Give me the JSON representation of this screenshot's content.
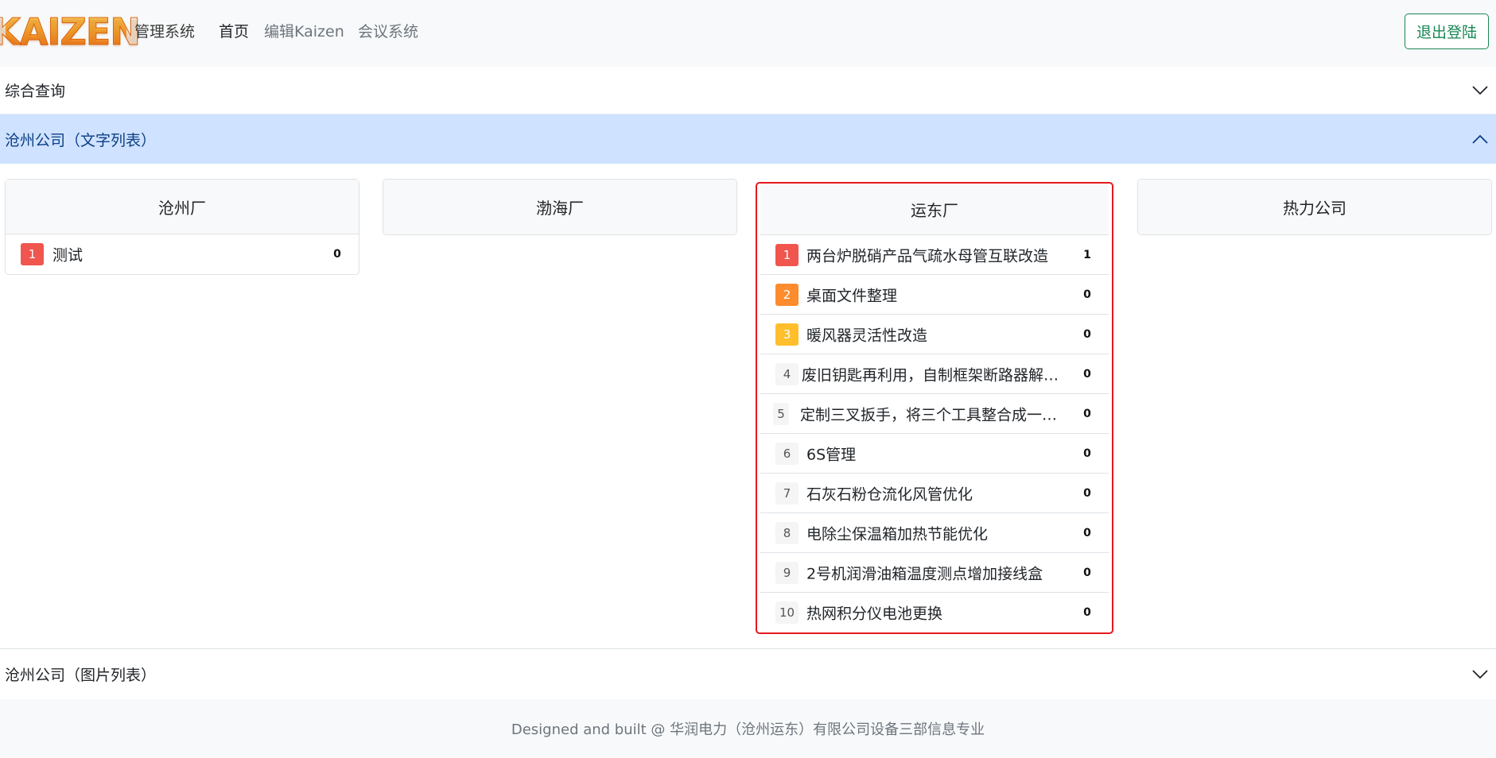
{
  "navbar": {
    "logo_text": "KAIZEN",
    "brand_text": "管理系统",
    "links": [
      {
        "label": "首页",
        "active": true
      },
      {
        "label": "编辑Kaizen",
        "active": false
      },
      {
        "label": "会议系统",
        "active": false
      }
    ],
    "logout_label": "退出登陆"
  },
  "accordion": [
    {
      "label": "综合查询",
      "expanded": false
    },
    {
      "label": "沧州公司（文字列表）",
      "expanded": true
    },
    {
      "label": "沧州公司（图片列表）",
      "expanded": false
    }
  ],
  "cards": [
    {
      "title": "沧州厂",
      "items": [
        {
          "rank": "1",
          "title": "测试",
          "count": "0"
        }
      ]
    },
    {
      "title": "渤海厂",
      "items": []
    },
    {
      "title": "运东厂",
      "highlighted": true,
      "items": [
        {
          "rank": "1",
          "title": "两台炉脱硝产品气疏水母管互联改造",
          "count": "1"
        },
        {
          "rank": "2",
          "title": "桌面文件整理",
          "count": "0"
        },
        {
          "rank": "3",
          "title": "暖风器灵活性改造",
          "count": "0"
        },
        {
          "rank": "4",
          "title": "废旧钥匙再利用，自制框架断路器解锁工具",
          "count": "0"
        },
        {
          "rank": "5",
          "title": "定制三叉扳手，将三个工具整合成一，方便携带使用",
          "count": "0"
        },
        {
          "rank": "6",
          "title": "6S管理",
          "count": "0"
        },
        {
          "rank": "7",
          "title": "石灰石粉仓流化风管优化",
          "count": "0"
        },
        {
          "rank": "8",
          "title": "电除尘保温箱加热节能优化",
          "count": "0"
        },
        {
          "rank": "9",
          "title": "2号机润滑油箱温度测点增加接线盒",
          "count": "0"
        },
        {
          "rank": "10",
          "title": "热网积分仪电池更换",
          "count": "0"
        }
      ]
    },
    {
      "title": "热力公司",
      "items": []
    }
  ],
  "footer": {
    "text": "Designed and built @ 华润电力（沧州运东）有限公司设备三部信息专业"
  },
  "colors": {
    "accent_success": "#198754",
    "accordion_active_bg": "#cfe2ff",
    "rank1": "#f0554e",
    "rank2": "#fd8c2e",
    "rank3": "#ffbe2c",
    "highlight_border": "#e5181d"
  }
}
